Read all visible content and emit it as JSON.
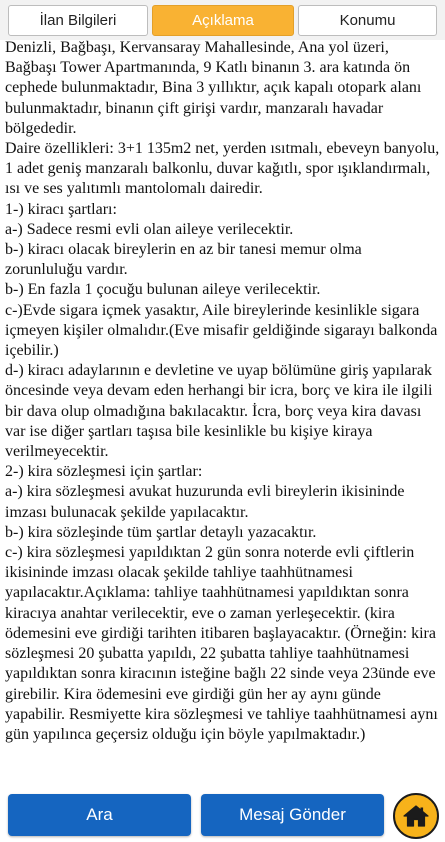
{
  "tabs": [
    {
      "label": "İlan Bilgileri"
    },
    {
      "label": "Açıklama"
    },
    {
      "label": "Konumu"
    }
  ],
  "description": "Denizli, Bağbaşı, Kervansaray Mahallesinde, Ana yol üzeri, Bağbaşı Tower Apartmanında, 9 Katlı binanın 3. ara katında ön cephede bulunmaktadır, Bina 3 yıllıktır, açık kapalı otopark alanı bulunmaktadır, binanın çift girişi vardır, manzaralı havadar bölgededir.\nDaire özellikleri: 3+1 135m2 net, yerden ısıtmalı, ebeveyn banyolu, 1 adet geniş manzaralı balkonlu, duvar kağıtlı, spor ışıklandırmalı, ısı ve ses yalıtımlı mantolomalı dairedir.\n1-) kiracı şartları:\na-) Sadece resmi evli olan aileye verilecektir.\nb-) kiracı olacak bireylerin en az bir tanesi memur olma zorunluluğu vardır.\nb-) En fazla 1 çocuğu bulunan aileye verilecektir.\nc-)Evde sigara içmek yasaktır, Aile bireylerinde kesinlikle sigara içmeyen kişiler olmalıdır.(Eve misafir geldiğinde sigarayı balkonda içebilir.)\nd-) kiracı adaylarının e devletine ve uyap bölümüne giriş yapılarak öncesinde veya devam eden herhangi bir icra, borç ve kira ile ilgili bir dava olup olmadığına bakılacaktır. İcra, borç veya kira davası var ise diğer şartları taşısa bile kesinlikle bu kişiye kiraya verilmeyecektir.\n2-) kira sözleşmesi için şartlar:\na-) kira sözleşmesi avukat huzurunda evli bireylerin ikisininde imzası bulunacak şekilde yapılacaktır.\nb-) kira sözleşinde tüm şartlar detaylı yazacaktır.\nc-) kira sözleşmesi yapıldıktan 2 gün sonra noterde evli çiftlerin ikisininde imzası olacak şekilde tahliye taahhütnamesi yapılacaktır.Açıklama: tahliye taahhütnamesi yapıldıktan sonra kiracıya anahtar verilecektir, eve o zaman yerleşecektir. (kira ödemesini eve girdiği tarihten itibaren başlayacaktır. (Örneğin: kira sözleşmesi 20 şubatta yapıldı, 22 şubatta tahliye taahhütnamesi yapıldıktan sonra kiracının isteğine bağlı 22 sinde veya 23ünde eve girebilir. Kira ödemesini eve girdiği gün her ay aynı günde yapabilir. Resmiyette kira sözleşmesi ve tahliye taahhütnamesi aynı gün yapılınca geçersiz olduğu için böyle yapılmaktadır.)",
  "buttons": {
    "call": "Ara",
    "message": "Mesaj Gönder"
  },
  "colors": {
    "accent": "#f9b233",
    "primary": "#1565c0",
    "home": "#f7b21a"
  },
  "icons": {
    "home": "home-icon"
  }
}
